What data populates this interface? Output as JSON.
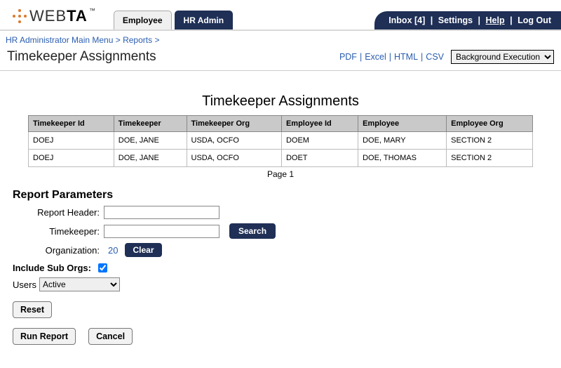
{
  "logo": {
    "text1": "WEB",
    "text2": "TA",
    "tm": "™"
  },
  "tabs": [
    {
      "label": "Employee",
      "active": false
    },
    {
      "label": "HR Admin",
      "active": true
    }
  ],
  "topbar": {
    "inbox": "Inbox [4]",
    "settings": "Settings",
    "help": "Help",
    "logout": "Log Out"
  },
  "breadcrumb": {
    "item1": "HR Administrator Main Menu",
    "item2": "Reports",
    "sep": ">"
  },
  "page_title": "Timekeeper Assignments",
  "export": {
    "pdf": "PDF",
    "excel": "Excel",
    "html": "HTML",
    "csv": "CSV",
    "bg_exec": "Background Execution"
  },
  "report_title": "Timekeeper Assignments",
  "columns": [
    "Timekeeper Id",
    "Timekeeper",
    "Timekeeper Org",
    "Employee Id",
    "Employee",
    "Employee Org"
  ],
  "rows": [
    [
      "DOEJ",
      "DOE, JANE",
      "USDA, OCFO",
      "DOEM",
      "DOE, MARY",
      "SECTION 2"
    ],
    [
      "DOEJ",
      "DOE, JANE",
      "USDA, OCFO",
      "DOET",
      "DOE, THOMAS",
      "SECTION 2"
    ]
  ],
  "pager": "Page 1",
  "params": {
    "title": "Report Parameters",
    "report_header_label": "Report Header:",
    "report_header_value": "",
    "timekeeper_label": "Timekeeper:",
    "timekeeper_value": "",
    "search_btn": "Search",
    "organization_label": "Organization:",
    "organization_value": "20",
    "clear_btn": "Clear",
    "include_sub_label": "Include Sub Orgs:",
    "include_sub_checked": true,
    "users_label": "Users",
    "users_value": "Active"
  },
  "buttons": {
    "reset": "Reset",
    "run": "Run Report",
    "cancel": "Cancel"
  }
}
